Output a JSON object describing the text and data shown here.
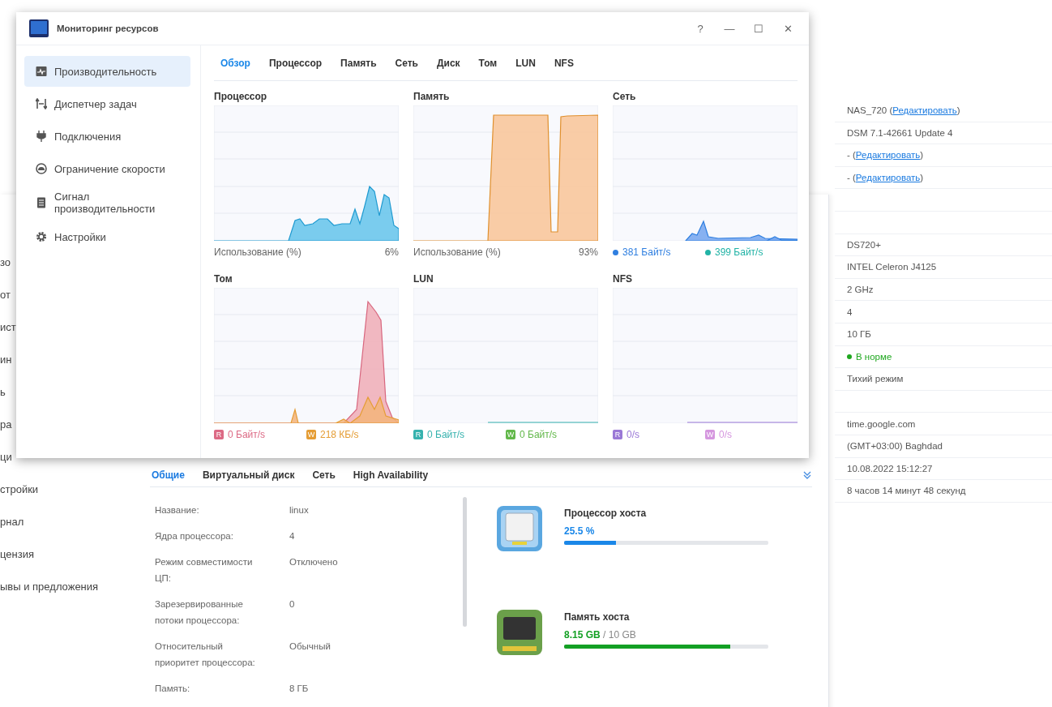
{
  "monitor_window": {
    "title": "Мониторинг ресурсов",
    "controls": [
      "?",
      "—",
      "☐",
      "✕"
    ],
    "sidebar": [
      {
        "label": "Производительность",
        "selected": true
      },
      {
        "label": "Диспетчер задач",
        "selected": false
      },
      {
        "label": "Подключения",
        "selected": false
      },
      {
        "label": "Ограничение скорости",
        "selected": false
      },
      {
        "label": "Сигнал производительности",
        "selected": false
      },
      {
        "label": "Настройки",
        "selected": false
      }
    ],
    "tabs": [
      {
        "label": "Обзор",
        "selected": true
      },
      {
        "label": "Процессор",
        "selected": false
      },
      {
        "label": "Память",
        "selected": false
      },
      {
        "label": "Сеть",
        "selected": false
      },
      {
        "label": "Диск",
        "selected": false
      },
      {
        "label": "Том",
        "selected": false
      },
      {
        "label": "LUN",
        "selected": false
      },
      {
        "label": "NFS",
        "selected": false
      }
    ],
    "panels": [
      {
        "title": "Процессор",
        "footer_label": "Использование  (%)",
        "footer_value": "6%"
      },
      {
        "title": "Память",
        "footer_label": "Использование  (%)",
        "footer_value": "93%"
      },
      {
        "title": "Сеть",
        "legend": [
          {
            "kind": "dot",
            "color": "#2f7fe0",
            "text": "381 Байт/s"
          },
          {
            "kind": "dot",
            "color": "#22b3a6",
            "text": "399 Байт/s"
          }
        ]
      },
      {
        "title": "Том",
        "legend": [
          {
            "kind": "badge",
            "letter": "R",
            "color": "#dc6a85",
            "text": "0 Байт/s"
          },
          {
            "kind": "badge",
            "letter": "W",
            "color": "#e59d35",
            "text": "218 КБ/s"
          }
        ]
      },
      {
        "title": "LUN",
        "legend": [
          {
            "kind": "badge",
            "letter": "R",
            "color": "#36b2ae",
            "text": "0 Байт/s"
          },
          {
            "kind": "badge",
            "letter": "W",
            "color": "#62b84a",
            "text": "0 Байт/s"
          }
        ]
      },
      {
        "title": "NFS",
        "legend": [
          {
            "kind": "badge",
            "letter": "R",
            "color": "#9a78d6",
            "text": "0/s"
          },
          {
            "kind": "badge",
            "letter": "W",
            "color": "#d597df",
            "text": "0/s"
          }
        ]
      }
    ]
  },
  "back_window": {
    "sidebar": [
      "зо",
      "от",
      "ист",
      "ин",
      "ь",
      "ра",
      "ци",
      "стройки",
      "рнал",
      "цензия",
      "ывы и предложения"
    ],
    "tabs": [
      {
        "label": "Общие",
        "selected": true
      },
      {
        "label": "Виртуальный диск",
        "selected": false
      },
      {
        "label": "Сеть",
        "selected": false
      },
      {
        "label": "High Availability",
        "selected": false
      }
    ],
    "properties": [
      {
        "label": "Название:",
        "value": "linux"
      },
      {
        "label": "Ядра процессора:",
        "value": "4"
      },
      {
        "label": "Режим совместимости ЦП:",
        "value": "Отключено"
      },
      {
        "label": "Зарезервированные потоки процессора:",
        "value": "0"
      },
      {
        "label": "Относительный приоритет процессора:",
        "value": "Обычный"
      },
      {
        "label": "Память:",
        "value": "8 ГБ"
      }
    ],
    "resources": [
      {
        "title": "Процессор хоста",
        "used": "25.5 %",
        "color": "#1a87e8",
        "level": 0.255
      },
      {
        "title": "Память хоста",
        "used": "8.15 GB",
        "total": "/ 10 GB",
        "color": "#13a024",
        "level": 0.815
      }
    ]
  },
  "info_panel": {
    "rows": [
      {
        "kind": "link",
        "prefix": "NAS_720 (",
        "link": "Редактировать",
        "suffix": ")"
      },
      {
        "kind": "text",
        "text": "DSM 7.1-42661 Update 4"
      },
      {
        "kind": "link",
        "prefix": "- (",
        "link": "Редактировать",
        "suffix": ")"
      },
      {
        "kind": "link",
        "prefix": "- (",
        "link": "Редактировать",
        "suffix": ")"
      },
      {
        "kind": "blank"
      },
      {
        "kind": "blank"
      },
      {
        "kind": "text",
        "text": "DS720+"
      },
      {
        "kind": "text",
        "text": "INTEL Celeron J4125"
      },
      {
        "kind": "text",
        "text": "2 GHz"
      },
      {
        "kind": "text",
        "text": "4"
      },
      {
        "kind": "text",
        "text": "10 ГБ"
      },
      {
        "kind": "status",
        "text": "В норме",
        "color": "#1fa71f"
      },
      {
        "kind": "text",
        "text": "Тихий режим"
      },
      {
        "kind": "blank"
      },
      {
        "kind": "text",
        "text": "time.google.com"
      },
      {
        "kind": "text",
        "text": "(GMT+03:00) Baghdad"
      },
      {
        "kind": "text",
        "text": "10.08.2022 15:12:27"
      },
      {
        "kind": "text",
        "text": "8 часов 14 минут 48 секунд"
      }
    ]
  }
}
